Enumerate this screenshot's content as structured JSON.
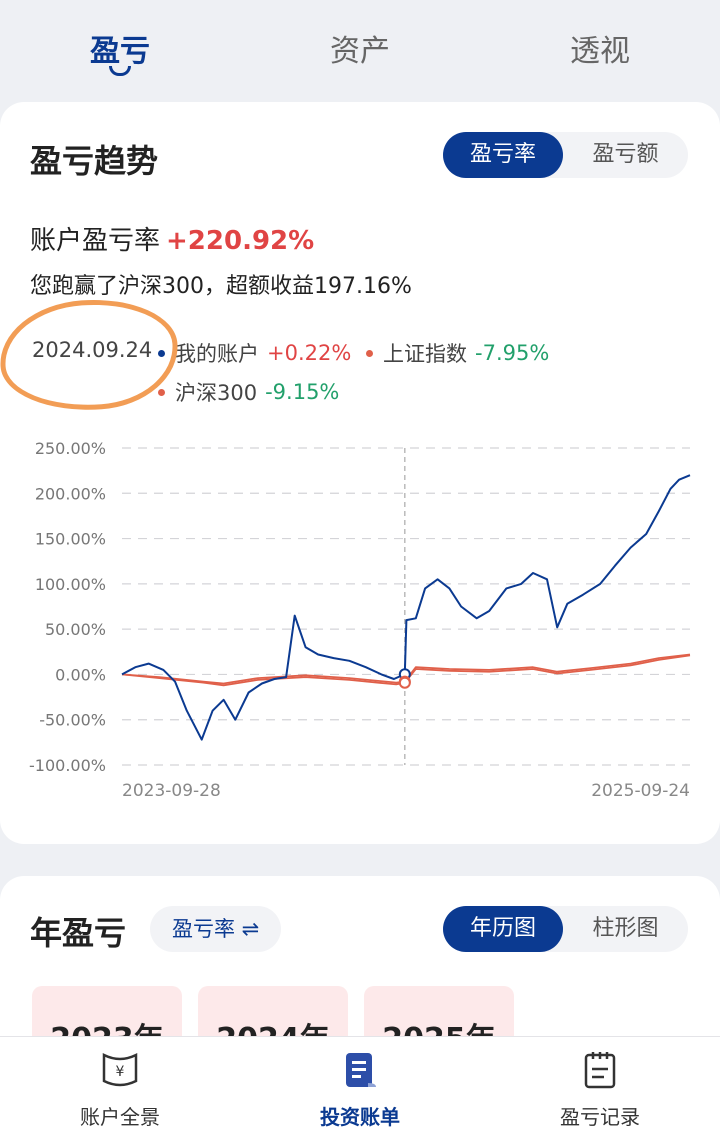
{
  "top_tabs": [
    "盈亏",
    "资产",
    "透视"
  ],
  "trend": {
    "title": "盈亏趋势",
    "toggle": [
      "盈亏率",
      "盈亏额"
    ],
    "account_rate_label": "账户盈亏率",
    "account_rate_value": "+220.92%",
    "beat_text": "您跑赢了沪深300，超额收益197.16%",
    "legend_date": "2024.09.24",
    "legend": [
      {
        "name": "我的账户",
        "value": "+0.22%",
        "color": "#0b3a91"
      },
      {
        "name": "上证指数",
        "value": "-7.95%",
        "color": "#e0604a"
      },
      {
        "name": "沪深300",
        "value": "-9.15%",
        "color": "#e0604a"
      }
    ]
  },
  "chart_data": {
    "type": "line",
    "y_ticks": [
      "250.00%",
      "200.00%",
      "150.00%",
      "100.00%",
      "50.00%",
      "0.00%",
      "-50.00%",
      "-100.00%"
    ],
    "ylim": [
      -100,
      250
    ],
    "x_tick_labels": [
      "2023-09-28",
      "2025-09-24"
    ],
    "xlim": [
      "2023-09-28",
      "2025-09-24"
    ],
    "grid": "dashed horizontal",
    "crosshair_x": "2024-09-24",
    "series": [
      {
        "name": "我的账户",
        "color": "#0b3a91",
        "x": [
          "2023-09-28",
          "2023-10-15",
          "2023-11-01",
          "2023-11-20",
          "2023-12-05",
          "2023-12-20",
          "2024-01-08",
          "2024-01-22",
          "2024-02-05",
          "2024-02-20",
          "2024-03-08",
          "2024-03-25",
          "2024-04-10",
          "2024-04-25",
          "2024-05-06",
          "2024-05-20",
          "2024-06-05",
          "2024-06-25",
          "2024-07-15",
          "2024-08-05",
          "2024-08-25",
          "2024-09-10",
          "2024-09-24",
          "2024-09-26",
          "2024-10-08",
          "2024-10-20",
          "2024-11-05",
          "2024-11-20",
          "2024-12-05",
          "2024-12-25",
          "2025-01-10",
          "2025-02-01",
          "2025-02-20",
          "2025-03-07",
          "2025-03-25",
          "2025-04-07",
          "2025-04-20",
          "2025-05-10",
          "2025-06-01",
          "2025-06-20",
          "2025-07-10",
          "2025-07-30",
          "2025-08-15",
          "2025-08-30",
          "2025-09-10",
          "2025-09-24"
        ],
        "values": [
          0,
          8,
          12,
          5,
          -8,
          -40,
          -72,
          -40,
          -28,
          -50,
          -20,
          -10,
          -5,
          -3,
          65,
          30,
          22,
          18,
          15,
          8,
          0,
          -5,
          0.2,
          60,
          62,
          95,
          105,
          95,
          75,
          62,
          70,
          95,
          100,
          112,
          105,
          52,
          78,
          88,
          100,
          120,
          140,
          155,
          180,
          205,
          215,
          220
        ]
      },
      {
        "name": "上证指数",
        "color": "#e0604a",
        "x": [
          "2023-09-28",
          "2023-11-15",
          "2024-01-10",
          "2024-02-05",
          "2024-03-20",
          "2024-05-20",
          "2024-07-15",
          "2024-09-13",
          "2024-09-24",
          "2024-10-08",
          "2024-11-20",
          "2025-01-10",
          "2025-03-07",
          "2025-04-07",
          "2025-05-20",
          "2025-07-10",
          "2025-08-15",
          "2025-09-24"
        ],
        "values": [
          0,
          -3,
          -8,
          -10,
          -4,
          -1,
          -4,
          -9,
          -7.95,
          8,
          6,
          5,
          8,
          3,
          7,
          12,
          18,
          22
        ]
      },
      {
        "name": "沪深300",
        "color": "#e0604a",
        "x": [
          "2023-09-28",
          "2023-11-15",
          "2024-01-10",
          "2024-02-05",
          "2024-03-20",
          "2024-05-20",
          "2024-07-15",
          "2024-09-13",
          "2024-09-24",
          "2024-10-08",
          "2024-11-20",
          "2025-01-10",
          "2025-03-07",
          "2025-04-07",
          "2025-05-20",
          "2025-07-10",
          "2025-08-15",
          "2025-09-24"
        ],
        "values": [
          0,
          -4,
          -9,
          -12,
          -6,
          -3,
          -6,
          -11,
          -9.15,
          6,
          4,
          3,
          6,
          1,
          5,
          10,
          16,
          21
        ]
      }
    ]
  },
  "yearly": {
    "title": "年盈亏",
    "metric_button": "盈亏率 ⇌",
    "toggle": [
      "年历图",
      "柱形图"
    ],
    "years": [
      "2023年",
      "2024年",
      "2025年"
    ]
  },
  "bottom_nav": [
    "账户全景",
    "投资账单",
    "盈亏记录"
  ]
}
